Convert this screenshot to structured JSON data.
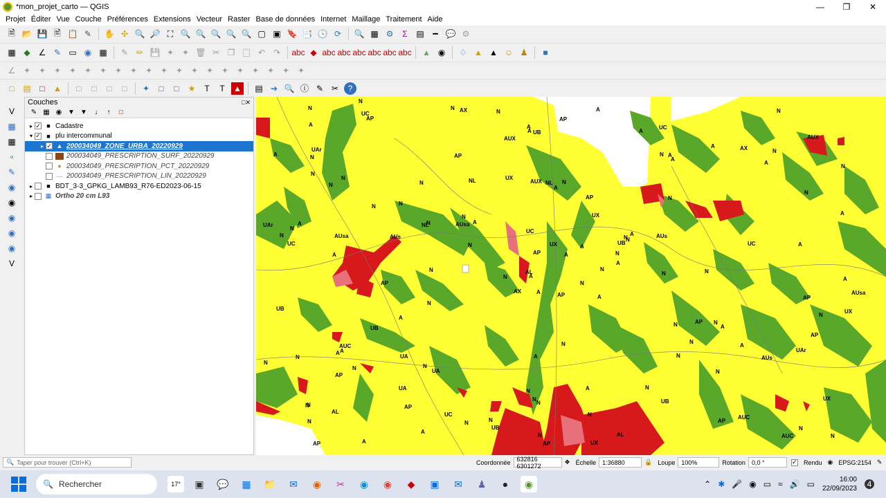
{
  "window": {
    "title": "*mon_projet_carto — QGIS"
  },
  "menu": [
    "Projet",
    "Éditer",
    "Vue",
    "Couche",
    "Préférences",
    "Extensions",
    "Vecteur",
    "Raster",
    "Base de données",
    "Internet",
    "Maillage",
    "Traitement",
    "Aide"
  ],
  "layers_panel": {
    "title": "Couches",
    "items": [
      {
        "label": "Cadastre",
        "checked": true,
        "expanded": false
      },
      {
        "label": "plu intercommunal",
        "checked": true,
        "expanded": true
      },
      {
        "label": "200034049_ZONE_URBA_20220929",
        "checked": true,
        "selected": true
      },
      {
        "label": "200034049_PRESCRIPTION_SURF_20220929",
        "checked": false
      },
      {
        "label": "200034049_PRESCRIPTION_PCT_20220929",
        "checked": false
      },
      {
        "label": "200034049_PRESCRIPTION_LIN_20220929",
        "checked": false
      },
      {
        "label": "BDT_3-3_GPKG_LAMB93_R76-ED2023-06-15",
        "checked": false
      },
      {
        "label": "Ortho 20 cm L93",
        "checked": false
      }
    ]
  },
  "map": {
    "colors": {
      "A": "#ffff33",
      "N": "#5aa82a",
      "U": "#d7191c",
      "AU": "#e8707a",
      "empty": "#ffffff"
    },
    "labels": [
      "AP",
      "UB",
      "UA",
      "UC",
      "N",
      "A",
      "AX",
      "AUX",
      "UX",
      "NL",
      "AL",
      "AUC",
      "AUsa",
      "AUs",
      "UAr"
    ]
  },
  "status": {
    "locator_placeholder": "Taper pour trouver (Ctrl+K)",
    "coord_label": "Coordonnée",
    "coord_value": "632816 6301272",
    "scale_label": "Échelle",
    "scale_value": "1:36880",
    "magnifier_label": "Loupe",
    "magnifier_value": "100%",
    "rotation_label": "Rotation",
    "rotation_value": "0,0 °",
    "render_label": "Rendu",
    "crs": "EPSG:2154"
  },
  "taskbar": {
    "search": "Rechercher",
    "weather": "17°",
    "time": "16:00",
    "date": "22/09/2023",
    "notifications": "4"
  }
}
